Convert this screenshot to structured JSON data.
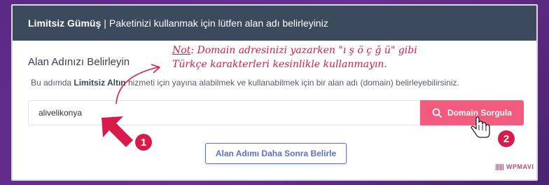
{
  "header": {
    "package_name": "Limitsiz Gümüş",
    "separator": "|",
    "instruction": "Paketinizi kullanmak için lütfen alan adı belirleyiniz"
  },
  "section": {
    "title": "Alan Adınızı Belirleyin",
    "desc_before": "Bu adımda",
    "desc_package": "Limitsiz Altın",
    "desc_after": "hizmeti için yayına alabilmek ve kullanabilmek için bir alan adı (domain) belirleyebilirsiniz."
  },
  "note": {
    "label": "Not",
    "line1": ": Domain adresinizi yazarken  \"ı ş ö ç ğ ü\" gibi",
    "line2": "Türkçe karakterleri kesinlikle kullanmayın."
  },
  "domain_input": {
    "value": "alivelikonya"
  },
  "domain_button": {
    "label": "Domain Sorgula",
    "icon": "search-icon"
  },
  "later_button": {
    "label": "Alan Adımı Daha Sonra Belirle"
  },
  "annotations": {
    "badge_1": "1",
    "badge_2": "2",
    "accent_color": "#d81b4a"
  },
  "watermark": {
    "text": "WPMAVI"
  },
  "colors": {
    "header_bg": "#3b4a5c",
    "primary_button": "#f25a7e",
    "secondary_border": "#5a6fd8",
    "background": "#5b2a86"
  }
}
